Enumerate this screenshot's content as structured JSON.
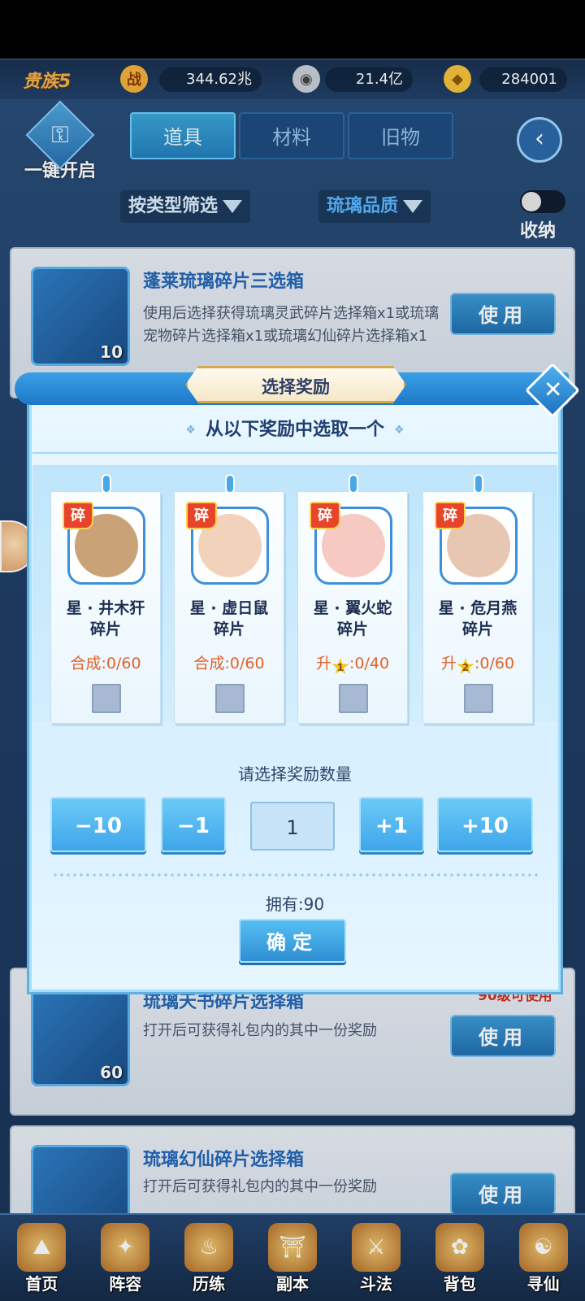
{
  "topbar": {
    "rank": "贵族5",
    "power_icon_glyph": "战",
    "power": "344.62兆",
    "coins": "21.4亿",
    "gold": "284001"
  },
  "actions": {
    "onekey_label": "一键开启",
    "tabs": [
      {
        "label": "道具",
        "active": true
      },
      {
        "label": "材料",
        "active": false
      },
      {
        "label": "旧物",
        "active": false
      }
    ],
    "filter_type": "按类型筛选",
    "filter_quality": "琉璃品质",
    "toggle_label": "收纳"
  },
  "items": [
    {
      "title": "蓬莱琉璃碎片三选箱",
      "desc": "使用后选择获得琉璃灵武碎片选择箱x1或琉璃宠物碎片选择箱x1或琉璃幻仙碎片选择箱x1",
      "qty": "10",
      "button": "使用"
    },
    {
      "title": "琉璃天书碎片选择箱",
      "desc": "打开后可获得礼包内的其中一份奖励",
      "qty": "60",
      "level_req": "90级可使用",
      "button": "使用"
    },
    {
      "title": "琉璃幻仙碎片选择箱",
      "desc": "打开后可获得礼包内的其中一份奖励",
      "button": "使用"
    }
  ],
  "modal": {
    "title": "选择奖励",
    "subtitle": "从以下奖励中选取一个",
    "close_glyph": "✕",
    "rewards": [
      {
        "tag": "碎",
        "name1": "星 · 井木犴",
        "name2": "碎片",
        "prog_prefix": "合成",
        "star": "",
        "prog": ":0/60",
        "face_color": "#c9a278"
      },
      {
        "tag": "碎",
        "name1": "星 · 虚日鼠",
        "name2": "碎片",
        "prog_prefix": "合成",
        "star": "",
        "prog": ":0/60",
        "face_color": "#f3d2bc"
      },
      {
        "tag": "碎",
        "name1": "星 · 翼火蛇",
        "name2": "碎片",
        "prog_prefix": "升",
        "star": "1",
        "prog": ":0/40",
        "face_color": "#f6c9c2"
      },
      {
        "tag": "碎",
        "name1": "星 · 危月燕",
        "name2": "碎片",
        "prog_prefix": "升",
        "star": "2",
        "prog": ":0/60",
        "face_color": "#e8c7b2"
      }
    ],
    "quantity_label": "请选择奖励数量",
    "btn_minus10": "−10",
    "btn_minus1": "−1",
    "quantity_value": "1",
    "btn_plus1": "+1",
    "btn_plus10": "+10",
    "owned": "拥有:90",
    "confirm": "确定"
  },
  "bottom_nav": [
    {
      "label": "首页"
    },
    {
      "label": "阵容"
    },
    {
      "label": "历练"
    },
    {
      "label": "副本"
    },
    {
      "label": "斗法"
    },
    {
      "label": "背包"
    },
    {
      "label": "寻仙"
    }
  ]
}
